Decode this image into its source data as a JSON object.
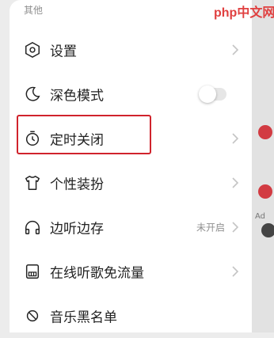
{
  "section_header": "其他",
  "watermark": "php中文网",
  "colors": {
    "accent": "#d0232c",
    "text": "#222222",
    "muted": "#8f8f8f"
  },
  "rows": [
    {
      "label": "设置",
      "icon": "settings-icon"
    },
    {
      "label": "深色模式",
      "icon": "moon-icon",
      "toggle": false
    },
    {
      "label": "定时关闭",
      "icon": "timer-icon"
    },
    {
      "label": "个性装扮",
      "icon": "shirt-icon"
    },
    {
      "label": "边听边存",
      "icon": "headphones-icon",
      "status": "未开启"
    },
    {
      "label": "在线听歌免流量",
      "icon": "sim-card-icon"
    },
    {
      "label": "音乐黑名单",
      "icon": "block-icon"
    }
  ],
  "right_strip": {
    "label": "Ad"
  }
}
